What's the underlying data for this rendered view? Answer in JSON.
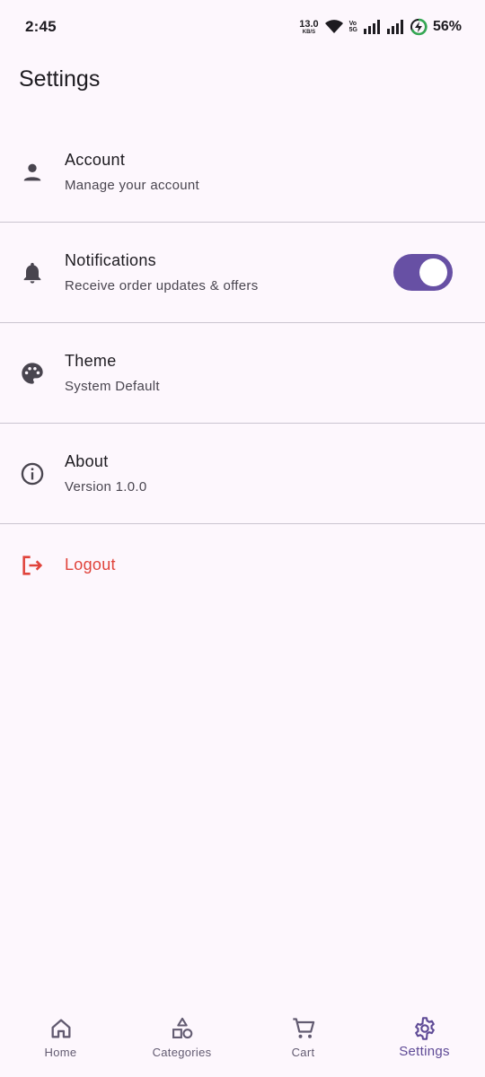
{
  "status_bar": {
    "time": "2:45",
    "net_speed_value": "13.0",
    "net_speed_unit": "KB/S",
    "volte_top": "Vo",
    "volte_bottom": "5G",
    "battery_percent": "56%",
    "icons": [
      "wifi-icon",
      "signal-icon",
      "signal-icon",
      "battery-charging-icon"
    ]
  },
  "header": {
    "title": "Settings"
  },
  "settings": {
    "items": [
      {
        "icon": "person-icon",
        "title": "Account",
        "subtitle": "Manage your account"
      },
      {
        "icon": "bell-icon",
        "title": "Notifications",
        "subtitle": "Receive order updates & offers",
        "toggle_on": true
      },
      {
        "icon": "palette-icon",
        "title": "Theme",
        "subtitle": "System Default"
      },
      {
        "icon": "info-icon",
        "title": "About",
        "subtitle": "Version 1.0.0"
      }
    ],
    "logout": {
      "icon": "logout-icon",
      "label": "Logout"
    }
  },
  "bottom_nav": {
    "items": [
      {
        "icon": "home-icon",
        "label": "Home"
      },
      {
        "icon": "categories-icon",
        "label": "Categories"
      },
      {
        "icon": "cart-icon",
        "label": "Cart"
      },
      {
        "icon": "settings-gear-icon",
        "label": "Settings",
        "active": true
      }
    ]
  },
  "colors": {
    "background": "#fdf7fd",
    "accent": "#6750a4",
    "logout": "#e0433b",
    "divider": "#cac4d0"
  }
}
